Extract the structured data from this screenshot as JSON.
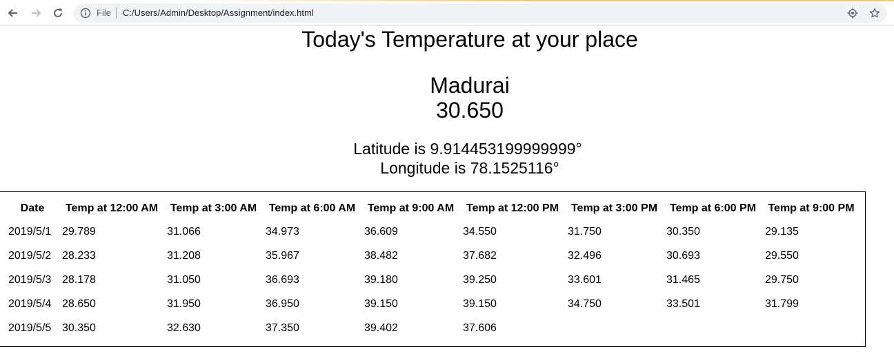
{
  "browser": {
    "scheme_label": "File",
    "url": "C:/Users/Admin/Desktop/Assignment/index.html",
    "icons": [
      "back-arrow-icon",
      "forward-arrow-icon",
      "reload-icon",
      "info-icon",
      "location-icon",
      "star-icon"
    ]
  },
  "page": {
    "title": "Today's Temperature at your place",
    "city": "Madurai",
    "current_temp": "30.650",
    "latitude": "Latitude is 9.914453199999999°",
    "longitude": "Longitude is 78.1525116°"
  },
  "table": {
    "headers": [
      "Date",
      "Temp at 12:00 AM",
      "Temp at 3:00 AM",
      "Temp at 6:00 AM",
      "Temp at 9:00 AM",
      "Temp at 12:00 PM",
      "Temp at 3:00 PM",
      "Temp at 6:00 PM",
      "Temp at 9:00 PM"
    ],
    "rows": [
      [
        "2019/5/1",
        "29.789",
        "31.066",
        "34.973",
        "36.609",
        "34.550",
        "31.750",
        "30.350",
        "29.135"
      ],
      [
        "2019/5/2",
        "28.233",
        "31.208",
        "35.967",
        "38.482",
        "37.682",
        "32.496",
        "30.693",
        "29.550"
      ],
      [
        "2019/5/3",
        "28.178",
        "31.050",
        "36.693",
        "39.180",
        "39.250",
        "33.601",
        "31.465",
        "29.750"
      ],
      [
        "2019/5/4",
        "28.650",
        "31.950",
        "36.950",
        "39.150",
        "39.150",
        "34.750",
        "33.501",
        "31.799"
      ],
      [
        "2019/5/5",
        "30.350",
        "32.630",
        "37.350",
        "39.402",
        "37.606",
        "",
        "",
        ""
      ]
    ]
  }
}
